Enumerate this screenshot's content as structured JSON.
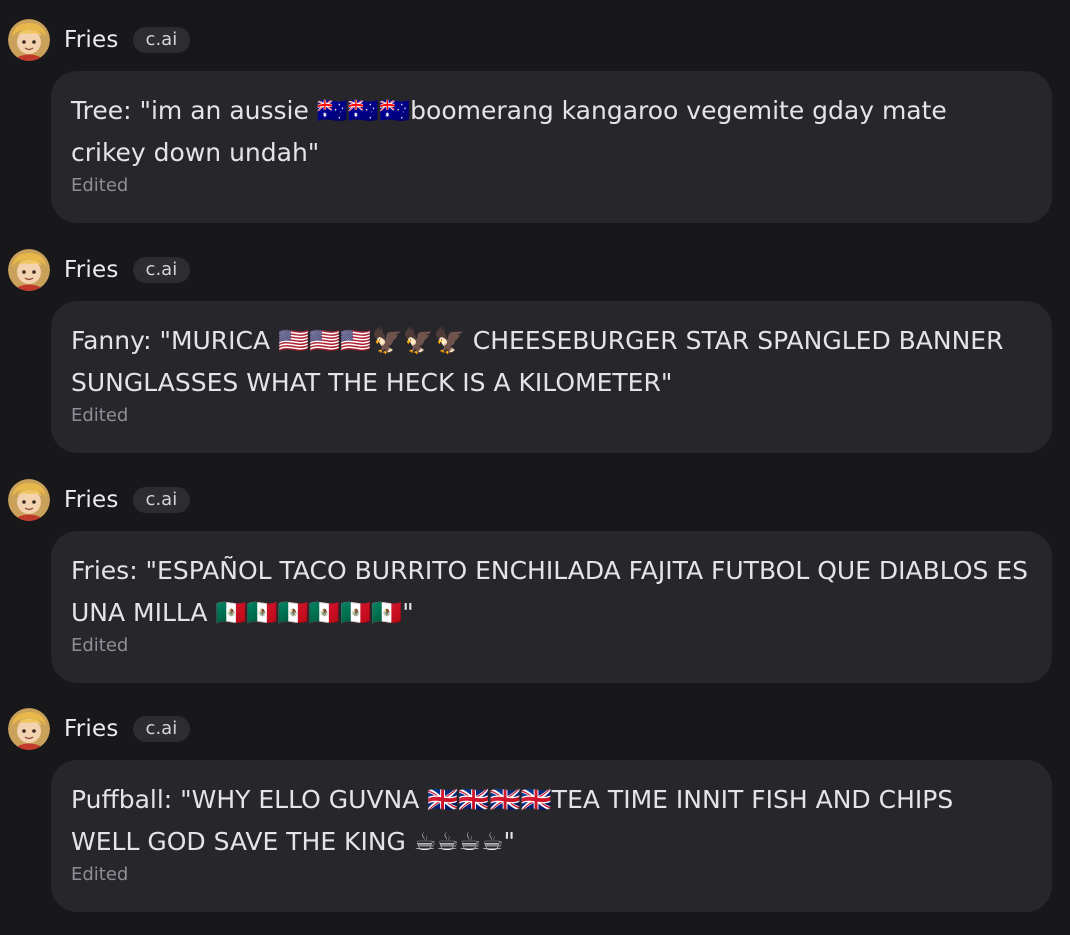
{
  "messages": [
    {
      "author": "Fries",
      "badge": "c.ai",
      "text": "Tree: \"im an aussie 🇦🇺🇦🇺🇦🇺boomerang kangaroo vegemite gday mate crikey down undah\"",
      "status": "Edited"
    },
    {
      "author": "Fries",
      "badge": "c.ai",
      "text": "Fanny: \"MURICA 🇺🇸🇺🇸🇺🇸🦅🦅🦅 CHEESEBURGER STAR SPANGLED BANNER SUNGLASSES WHAT THE HECK IS A KILOMETER\"",
      "status": "Edited"
    },
    {
      "author": "Fries",
      "badge": "c.ai",
      "text": "Fries: \"ESPAÑOL TACO BURRITO ENCHILADA FAJITA FUTBOL QUE DIABLOS ES UNA MILLA 🇲🇽🇲🇽🇲🇽🇲🇽🇲🇽🇲🇽\"",
      "status": "Edited"
    },
    {
      "author": "Fries",
      "badge": "c.ai",
      "text": "Puffball: \"WHY ELLO GUVNA 🇬🇧🇬🇧🇬🇧🇬🇧TEA TIME INNIT FISH AND CHIPS WELL GOD SAVE THE KING ☕☕☕☕\"",
      "status": "Edited"
    }
  ],
  "icons": {
    "avatar": "character-avatar-icon"
  },
  "colors": {
    "background": "#18181b",
    "bubble": "#26262b",
    "badge": "#2c2c31",
    "edited_text": "#8e8e96"
  }
}
